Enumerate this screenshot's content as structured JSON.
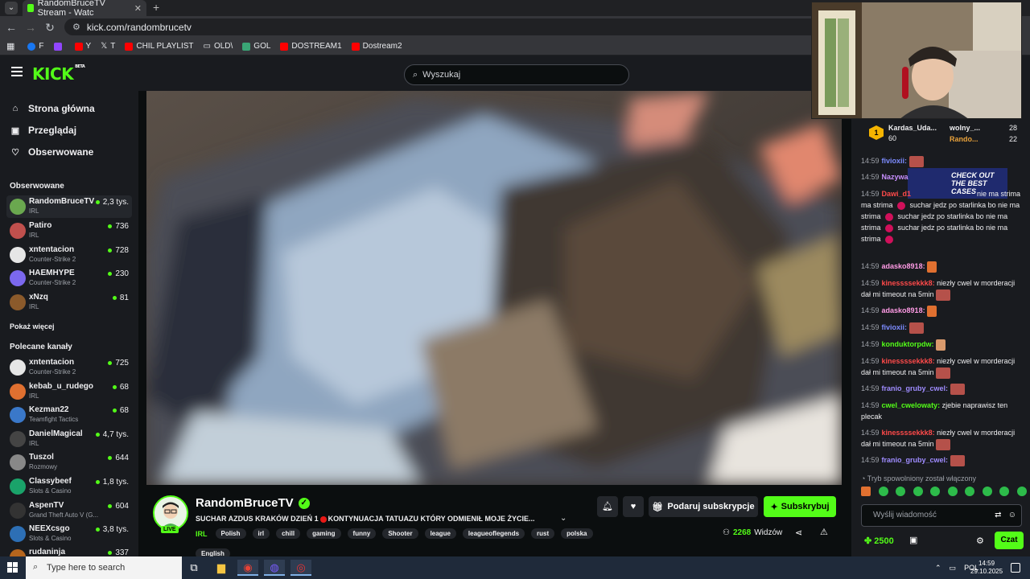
{
  "browser": {
    "tab_title": "RandomBruceTV Stream - Watc",
    "url": "kick.com/randombrucetv",
    "bookmarks": [
      {
        "label": "F",
        "color": "#1877f2"
      },
      {
        "label": "",
        "color": "#9146ff"
      },
      {
        "label": "Y",
        "color": "#ff0000"
      },
      {
        "label": "T",
        "color": "#000000"
      },
      {
        "label": "CHIL PLAYLIST",
        "color": "#ff0000"
      },
      {
        "label": "OLD\\",
        "color": "#aaaaaa"
      },
      {
        "label": "GOL",
        "color": "#3aa676"
      },
      {
        "label": "DOSTREAM1",
        "color": "#ff0000"
      },
      {
        "label": "Dostream2",
        "color": "#ff0000"
      }
    ]
  },
  "header": {
    "logo": "KICK",
    "logo_badge": "BETA",
    "search_placeholder": "Wyszukaj"
  },
  "sidebar": {
    "nav": [
      {
        "label": "Strona główna",
        "icon": "home-icon"
      },
      {
        "label": "Przeglądaj",
        "icon": "browse-icon"
      },
      {
        "label": "Obserwowane",
        "icon": "heart-icon"
      }
    ],
    "following_title": "Obserwowane",
    "following": [
      {
        "name": "RandomBruceTV",
        "category": "IRL",
        "viewers": "2,3 tys.",
        "color": "#6aa84f"
      },
      {
        "name": "Patiro",
        "category": "IRL",
        "viewers": "736",
        "color": "#c0504d"
      },
      {
        "name": "xntentacion",
        "category": "Counter-Strike 2",
        "viewers": "728",
        "color": "#e6e6e6"
      },
      {
        "name": "HAEMHYPE",
        "category": "Counter-Strike 2",
        "viewers": "230",
        "color": "#7b68ee"
      },
      {
        "name": "xNzq",
        "category": "IRL",
        "viewers": "81",
        "color": "#8b5a2b"
      }
    ],
    "show_more": "Pokaż więcej",
    "recommended_title": "Polecane kanały",
    "recommended": [
      {
        "name": "xntentacion",
        "category": "Counter-Strike 2",
        "viewers": "725",
        "color": "#e6e6e6"
      },
      {
        "name": "kebab_u_rudego",
        "category": "IRL",
        "viewers": "68",
        "color": "#e07030"
      },
      {
        "name": "Kezman22",
        "category": "Teamfight Tactics",
        "viewers": "68",
        "color": "#3a78c9"
      },
      {
        "name": "DanielMagical",
        "category": "IRL",
        "viewers": "4,7 tys.",
        "color": "#444444"
      },
      {
        "name": "Tuszol",
        "category": "Rozmowy",
        "viewers": "644",
        "color": "#888888"
      },
      {
        "name": "Classybeef",
        "category": "Slots & Casino",
        "viewers": "1,8 tys.",
        "color": "#1aa36a"
      },
      {
        "name": "AspenTV",
        "category": "Grand Theft Auto V (G...",
        "viewers": "604",
        "color": "#333333"
      },
      {
        "name": "NEEXcsgo",
        "category": "Slots & Casino",
        "viewers": "3,8 tys.",
        "color": "#2d6fb5"
      },
      {
        "name": "rudaninja",
        "category": "",
        "viewers": "337",
        "color": "#b5651d"
      }
    ]
  },
  "stream": {
    "channel": "RandomBruceTV",
    "live_label": "LIVE",
    "title_part1": "SUCHAR AZDUS KRAKÓW DZIEŃ 1",
    "title_part2": "KONTYNUACJA TATUAZU KTÓRY ODMIENIŁ MOJE  ŻYCIE...",
    "category": "IRL",
    "tags": [
      "Polish",
      "irl",
      "chill",
      "gaming",
      "funny",
      "Shooter",
      "league",
      "leagueoflegends",
      "rust",
      "polska"
    ],
    "tag_extra": "English",
    "gift_label": "Podaruj subskrypcje",
    "subscribe_label": "Subskrybuj",
    "viewer_count": "2268",
    "viewer_label": "Widzów"
  },
  "chat": {
    "top_gifters": [
      {
        "name": "Kardas_Uda...",
        "count": "60",
        "rank": "1"
      },
      {
        "name": "wolny_...",
        "count": "28"
      },
      {
        "name": "Rando...",
        "count": "22"
      }
    ],
    "ad_text_1": "CHECK OUT",
    "ad_text_2": "THE BEST",
    "ad_text_3": "CASES",
    "messages": [
      {
        "time": "14:59",
        "user": "fivioxii:",
        "color": "#7d8cff",
        "text": ""
      },
      {
        "time": "14:59",
        "user": "Nazywa",
        "color": "#c890ff",
        "text": ""
      },
      {
        "time": "14:59",
        "user": "Dawi_d1",
        "color": "#ff4a4a",
        "text": "nie ma strima"
      },
      {
        "time": "",
        "user": "",
        "color": "",
        "text": "suchar jedz po starlinka bo nie ma strima"
      },
      {
        "time": "",
        "user": "",
        "color": "",
        "text": "suchar jedz po starlinka bo nie ma strima"
      },
      {
        "time": "",
        "user": "",
        "color": "",
        "text": "suchar jedz po starlinka bo nie ma strima"
      },
      {
        "time": "14:59",
        "user": "adasko8918:",
        "color": "#ff9be5",
        "text": ""
      },
      {
        "time": "14:59",
        "user": "kinessssekkk8:",
        "color": "#ff4a4a",
        "text": "niezły cwel w morderacji dał mi timeout na 5min"
      },
      {
        "time": "14:59",
        "user": "adasko8918:",
        "color": "#ff9be5",
        "text": ""
      },
      {
        "time": "14:59",
        "user": "fivioxii:",
        "color": "#7d8cff",
        "text": ""
      },
      {
        "time": "14:59",
        "user": "konduktorpdw:",
        "color": "#53fc18",
        "text": ""
      },
      {
        "time": "14:59",
        "user": "kinessssekkk8:",
        "color": "#ff4a4a",
        "text": "niezły cwel w morderacji dał mi timeout na 5min"
      },
      {
        "time": "14:59",
        "user": "franio_gruby_cwel:",
        "color": "#9f8cff",
        "text": ""
      },
      {
        "time": "14:59",
        "user": "cwel_cwelowaty:",
        "color": "#53fc18",
        "text": "zjebie naprawisz ten plecak"
      },
      {
        "time": "14:59",
        "user": "kinessssekkk8:",
        "color": "#ff4a4a",
        "text": "niezły cwel w morderacji dał mi timeout na 5min"
      },
      {
        "time": "14:59",
        "user": "franio_gruby_cwel:",
        "color": "#9f8cff",
        "text": ""
      }
    ],
    "slow_mode": "Tryb spowolniony został włączony",
    "input_placeholder": "Wyślij wiadomość",
    "points": "2500",
    "send_label": "Czat"
  },
  "taskbar": {
    "search_placeholder": "Type here to search",
    "lang": "POL",
    "time": "14:59",
    "date": "29.10.2025"
  }
}
